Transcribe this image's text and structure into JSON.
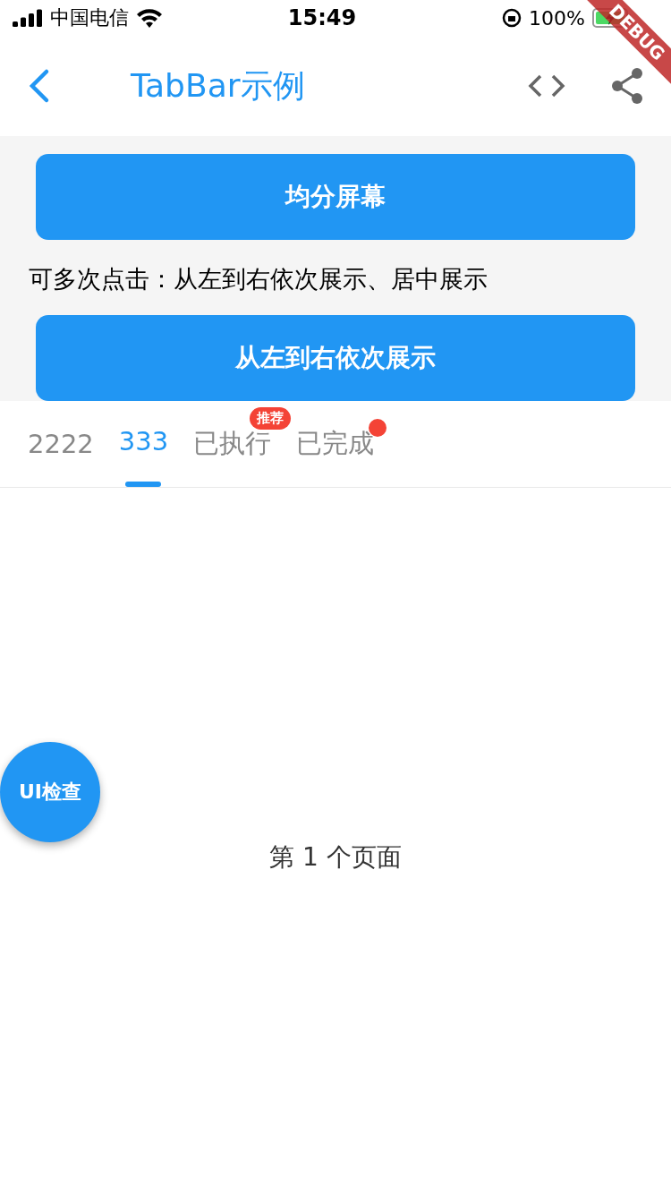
{
  "status_bar": {
    "carrier": "中国电信",
    "time": "15:49",
    "battery": "100%",
    "charging": true
  },
  "debug_banner": "DEBUG",
  "nav": {
    "title": "TabBar示例"
  },
  "buttons": [
    {
      "label": "均分屏幕"
    },
    {
      "label": "从左到右依次展示"
    }
  ],
  "hint": "可多次点击：从左到右依次展示、居中展示",
  "tabs": [
    {
      "label": "2222",
      "selected": false,
      "kind": "plain"
    },
    {
      "label": "333",
      "selected": true,
      "kind": "plain"
    },
    {
      "label": "已执行",
      "selected": false,
      "kind": "badge",
      "badge": "推荐"
    },
    {
      "label": "已完成",
      "selected": false,
      "kind": "dot"
    }
  ],
  "page_text": "第 1 个页面",
  "fab": "UI检查"
}
